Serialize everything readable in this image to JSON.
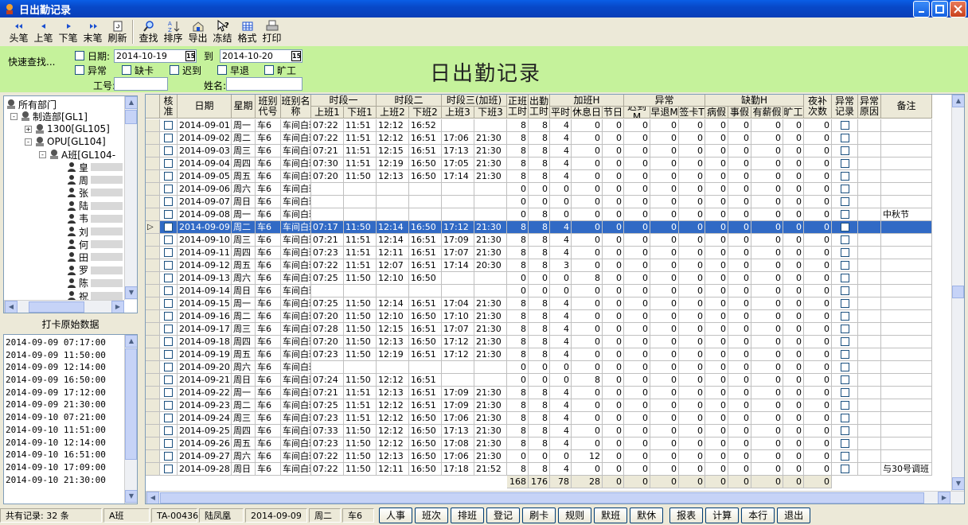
{
  "window": {
    "title": "日出勤记录"
  },
  "toolbar": {
    "buttons": [
      "头笔",
      "上笔",
      "下笔",
      "末笔",
      "刷新",
      "查找",
      "排序",
      "导出",
      "冻结",
      "格式",
      "打印"
    ]
  },
  "search": {
    "quick_label": "快速查找...",
    "date_label": "日期:",
    "date_from": "2014-10-19",
    "to_label": "到",
    "date_to": "2014-10-20",
    "abnormal": "异常",
    "missing_card": "缺卡",
    "late": "迟到",
    "early": "早退",
    "absent": "旷工",
    "emp_no_label": "工号:",
    "name_label": "姓名:",
    "big_title": "日出勤记录"
  },
  "tree": {
    "root": "所有部门",
    "n1": "制造部[GL1]",
    "n2": "1300[GL105]",
    "n3": "OPU[GL104]",
    "n4": "A班[GL104-",
    "people": [
      "皇",
      "周",
      "张",
      "陆",
      "韦",
      "刘",
      "何",
      "田",
      "罗",
      "陈",
      "祝"
    ]
  },
  "raw": {
    "header": "打卡原始数据",
    "items": [
      "2014-09-09 07:17:00",
      "2014-09-09 11:50:00",
      "2014-09-09 12:14:00",
      "2014-09-09 16:50:00",
      "2014-09-09 17:12:00",
      "2014-09-09 21:30:00",
      "2014-09-10 07:21:00",
      "2014-09-10 11:51:00",
      "2014-09-10 12:14:00",
      "2014-09-10 16:51:00",
      "2014-09-10 17:09:00",
      "2014-09-10 21:30:00"
    ]
  },
  "grid": {
    "headers": {
      "approved": "核准",
      "date": "日期",
      "week": "星期",
      "shift_code": "班别代号",
      "shift_name": "班别名称",
      "p1": "时段一",
      "p2": "时段二",
      "p3": "时段三(加班)",
      "on1": "上班1",
      "off1": "下班1",
      "on2": "上班2",
      "off2": "下班2",
      "on3": "上班3",
      "off3": "下班3",
      "normal": "正班工时",
      "attend": "出勤工时",
      "ot": "加班H",
      "ot_normal": "平时",
      "ot_rest": "休息日",
      "ot_holiday": "节日",
      "abn": "异常",
      "late": "迟到M",
      "early": "早退M",
      "sign": "签卡T",
      "leave": "缺勤H",
      "sick": "病假",
      "personal": "事假",
      "paid": "有薪假",
      "absent": "旷工",
      "night": "夜补次数",
      "abn_rec": "异常记录",
      "abn_reason": "异常原因",
      "remark": "备注"
    },
    "rows": [
      [
        "2014-09-01",
        "周一",
        "车6",
        "车间白班",
        "07:22",
        "11:51",
        "12:12",
        "16:52",
        "",
        "",
        "8",
        "8",
        "4",
        "0",
        "0",
        "0",
        "0",
        "0",
        "0",
        "0",
        "0",
        "0",
        "0",
        ""
      ],
      [
        "2014-09-02",
        "周二",
        "车6",
        "车间白班",
        "07:22",
        "11:51",
        "12:12",
        "16:51",
        "17:06",
        "21:30",
        "8",
        "8",
        "4",
        "0",
        "0",
        "0",
        "0",
        "0",
        "0",
        "0",
        "0",
        "0",
        "0",
        ""
      ],
      [
        "2014-09-03",
        "周三",
        "车6",
        "车间白班",
        "07:21",
        "11:51",
        "12:15",
        "16:51",
        "17:13",
        "21:30",
        "8",
        "8",
        "4",
        "0",
        "0",
        "0",
        "0",
        "0",
        "0",
        "0",
        "0",
        "0",
        "0",
        ""
      ],
      [
        "2014-09-04",
        "周四",
        "车6",
        "车间白班",
        "07:30",
        "11:51",
        "12:19",
        "16:50",
        "17:05",
        "21:30",
        "8",
        "8",
        "4",
        "0",
        "0",
        "0",
        "0",
        "0",
        "0",
        "0",
        "0",
        "0",
        "0",
        ""
      ],
      [
        "2014-09-05",
        "周五",
        "车6",
        "车间白班",
        "07:20",
        "11:50",
        "12:13",
        "16:50",
        "17:14",
        "21:30",
        "8",
        "8",
        "4",
        "0",
        "0",
        "0",
        "0",
        "0",
        "0",
        "0",
        "0",
        "0",
        "0",
        ""
      ],
      [
        "2014-09-06",
        "周六",
        "车6",
        "车间白班",
        "",
        "",
        "",
        "",
        "",
        "",
        "0",
        "0",
        "0",
        "0",
        "0",
        "0",
        "0",
        "0",
        "0",
        "0",
        "0",
        "0",
        "0",
        ""
      ],
      [
        "2014-09-07",
        "周日",
        "车6",
        "车间白班",
        "",
        "",
        "",
        "",
        "",
        "",
        "0",
        "0",
        "0",
        "0",
        "0",
        "0",
        "0",
        "0",
        "0",
        "0",
        "0",
        "0",
        "0",
        ""
      ],
      [
        "2014-09-08",
        "周一",
        "车6",
        "车间白班",
        "",
        "",
        "",
        "",
        "",
        "",
        "0",
        "8",
        "0",
        "0",
        "0",
        "0",
        "0",
        "0",
        "0",
        "0",
        "0",
        "0",
        "0",
        "中秋节"
      ],
      [
        "2014-09-09",
        "周二",
        "车6",
        "车间白班",
        "07:17",
        "11:50",
        "12:14",
        "16:50",
        "17:12",
        "21:30",
        "8",
        "8",
        "4",
        "0",
        "0",
        "0",
        "0",
        "0",
        "0",
        "0",
        "0",
        "0",
        "0",
        ""
      ],
      [
        "2014-09-10",
        "周三",
        "车6",
        "车间白班",
        "07:21",
        "11:51",
        "12:14",
        "16:51",
        "17:09",
        "21:30",
        "8",
        "8",
        "4",
        "0",
        "0",
        "0",
        "0",
        "0",
        "0",
        "0",
        "0",
        "0",
        "0",
        ""
      ],
      [
        "2014-09-11",
        "周四",
        "车6",
        "车间白班",
        "07:23",
        "11:51",
        "12:11",
        "16:51",
        "17:07",
        "21:30",
        "8",
        "8",
        "4",
        "0",
        "0",
        "0",
        "0",
        "0",
        "0",
        "0",
        "0",
        "0",
        "0",
        ""
      ],
      [
        "2014-09-12",
        "周五",
        "车6",
        "车间白班",
        "07:22",
        "11:51",
        "12:07",
        "16:51",
        "17:14",
        "20:30",
        "8",
        "8",
        "3",
        "0",
        "0",
        "0",
        "0",
        "0",
        "0",
        "0",
        "0",
        "0",
        "0",
        ""
      ],
      [
        "2014-09-13",
        "周六",
        "车6",
        "车间白班",
        "07:25",
        "11:50",
        "12:10",
        "16:50",
        "",
        "",
        "0",
        "0",
        "0",
        "8",
        "0",
        "0",
        "0",
        "0",
        "0",
        "0",
        "0",
        "0",
        "0",
        ""
      ],
      [
        "2014-09-14",
        "周日",
        "车6",
        "车间白班",
        "",
        "",
        "",
        "",
        "",
        "",
        "0",
        "0",
        "0",
        "0",
        "0",
        "0",
        "0",
        "0",
        "0",
        "0",
        "0",
        "0",
        "0",
        ""
      ],
      [
        "2014-09-15",
        "周一",
        "车6",
        "车间白班",
        "07:25",
        "11:50",
        "12:14",
        "16:51",
        "17:04",
        "21:30",
        "8",
        "8",
        "4",
        "0",
        "0",
        "0",
        "0",
        "0",
        "0",
        "0",
        "0",
        "0",
        "0",
        ""
      ],
      [
        "2014-09-16",
        "周二",
        "车6",
        "车间白班",
        "07:20",
        "11:50",
        "12:10",
        "16:50",
        "17:10",
        "21:30",
        "8",
        "8",
        "4",
        "0",
        "0",
        "0",
        "0",
        "0",
        "0",
        "0",
        "0",
        "0",
        "0",
        ""
      ],
      [
        "2014-09-17",
        "周三",
        "车6",
        "车间白班",
        "07:28",
        "11:50",
        "12:15",
        "16:51",
        "17:07",
        "21:30",
        "8",
        "8",
        "4",
        "0",
        "0",
        "0",
        "0",
        "0",
        "0",
        "0",
        "0",
        "0",
        "0",
        ""
      ],
      [
        "2014-09-18",
        "周四",
        "车6",
        "车间白班",
        "07:20",
        "11:50",
        "12:13",
        "16:50",
        "17:12",
        "21:30",
        "8",
        "8",
        "4",
        "0",
        "0",
        "0",
        "0",
        "0",
        "0",
        "0",
        "0",
        "0",
        "0",
        ""
      ],
      [
        "2014-09-19",
        "周五",
        "车6",
        "车间白班",
        "07:23",
        "11:50",
        "12:19",
        "16:51",
        "17:12",
        "21:30",
        "8",
        "8",
        "4",
        "0",
        "0",
        "0",
        "0",
        "0",
        "0",
        "0",
        "0",
        "0",
        "0",
        ""
      ],
      [
        "2014-09-20",
        "周六",
        "车6",
        "车间白班",
        "",
        "",
        "",
        "",
        "",
        "",
        "0",
        "0",
        "0",
        "0",
        "0",
        "0",
        "0",
        "0",
        "0",
        "0",
        "0",
        "0",
        "0",
        ""
      ],
      [
        "2014-09-21",
        "周日",
        "车6",
        "车间白班",
        "07:24",
        "11:50",
        "12:12",
        "16:51",
        "",
        "",
        "0",
        "0",
        "0",
        "8",
        "0",
        "0",
        "0",
        "0",
        "0",
        "0",
        "0",
        "0",
        "0",
        ""
      ],
      [
        "2014-09-22",
        "周一",
        "车6",
        "车间白班",
        "07:21",
        "11:51",
        "12:13",
        "16:51",
        "17:09",
        "21:30",
        "8",
        "8",
        "4",
        "0",
        "0",
        "0",
        "0",
        "0",
        "0",
        "0",
        "0",
        "0",
        "0",
        ""
      ],
      [
        "2014-09-23",
        "周二",
        "车6",
        "车间白班",
        "07:25",
        "11:51",
        "12:12",
        "16:51",
        "17:09",
        "21:30",
        "8",
        "8",
        "4",
        "0",
        "0",
        "0",
        "0",
        "0",
        "0",
        "0",
        "0",
        "0",
        "0",
        ""
      ],
      [
        "2014-09-24",
        "周三",
        "车6",
        "车间白班",
        "07:23",
        "11:51",
        "12:12",
        "16:50",
        "17:06",
        "21:30",
        "8",
        "8",
        "4",
        "0",
        "0",
        "0",
        "0",
        "0",
        "0",
        "0",
        "0",
        "0",
        "0",
        ""
      ],
      [
        "2014-09-25",
        "周四",
        "车6",
        "车间白班",
        "07:33",
        "11:50",
        "12:12",
        "16:50",
        "17:13",
        "21:30",
        "8",
        "8",
        "4",
        "0",
        "0",
        "0",
        "0",
        "0",
        "0",
        "0",
        "0",
        "0",
        "0",
        ""
      ],
      [
        "2014-09-26",
        "周五",
        "车6",
        "车间白班",
        "07:23",
        "11:50",
        "12:12",
        "16:50",
        "17:08",
        "21:30",
        "8",
        "8",
        "4",
        "0",
        "0",
        "0",
        "0",
        "0",
        "0",
        "0",
        "0",
        "0",
        "0",
        ""
      ],
      [
        "2014-09-27",
        "周六",
        "车6",
        "车间白班",
        "07:22",
        "11:50",
        "12:13",
        "16:50",
        "17:06",
        "21:30",
        "0",
        "0",
        "0",
        "12",
        "0",
        "0",
        "0",
        "0",
        "0",
        "0",
        "0",
        "0",
        "0",
        ""
      ],
      [
        "2014-09-28",
        "周日",
        "车6",
        "车间白班",
        "07:22",
        "11:50",
        "12:11",
        "16:50",
        "17:18",
        "21:52",
        "8",
        "8",
        "4",
        "0",
        "0",
        "0",
        "0",
        "0",
        "0",
        "0",
        "0",
        "0",
        "0",
        "与30号调班"
      ]
    ],
    "selected": 8,
    "totals": [
      "168",
      "176",
      "78",
      "28",
      "0",
      "0",
      "0",
      "0",
      "0",
      "0",
      "0",
      "0",
      "0"
    ]
  },
  "status": {
    "count": "共有记录: 32 条",
    "team": "A班",
    "emp": "TA-00436",
    "name": "陆凤凰",
    "date": "2014-09-09",
    "week": "周二",
    "shift": "车6",
    "buttons": [
      "人事",
      "班次",
      "排班",
      "登记",
      "刷卡",
      "规则",
      "默班",
      "默休",
      "报表",
      "计算",
      "本行",
      "退出"
    ]
  }
}
